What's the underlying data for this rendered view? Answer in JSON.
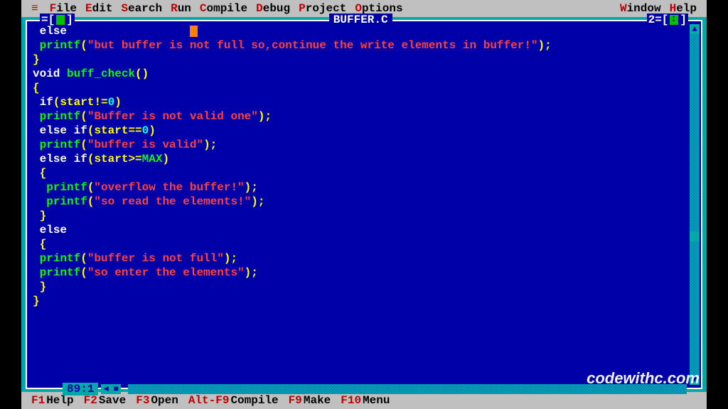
{
  "menu": {
    "items": [
      {
        "hk": "F",
        "rest": "ile"
      },
      {
        "hk": "E",
        "rest": "dit"
      },
      {
        "hk": "S",
        "rest": "earch"
      },
      {
        "hk": "R",
        "rest": "un"
      },
      {
        "hk": "C",
        "rest": "ompile"
      },
      {
        "hk": "D",
        "rest": "ebug"
      },
      {
        "hk": "P",
        "rest": "roject"
      },
      {
        "hk": "O",
        "rest": "ptions"
      }
    ],
    "right": [
      {
        "hk": "W",
        "rest": "indow"
      },
      {
        "hk": "H",
        "rest": "elp"
      }
    ]
  },
  "window": {
    "title": "BUFFER.C",
    "number": "2",
    "position": "89:1"
  },
  "code": [
    {
      "indent": " ",
      "tokens": [
        {
          "t": "else",
          "c": "kw"
        }
      ]
    },
    {
      "indent": " ",
      "tokens": [
        {
          "t": "printf",
          "c": "fn"
        },
        {
          "t": "(",
          "c": "sym"
        },
        {
          "t": "\"but buffer is not full so,continue the write elements in buffer!\"",
          "c": "str"
        },
        {
          "t": ");",
          "c": "sym"
        }
      ]
    },
    {
      "indent": "",
      "tokens": [
        {
          "t": "}",
          "c": "sym"
        }
      ]
    },
    {
      "indent": "",
      "tokens": [
        {
          "t": "void ",
          "c": "typ"
        },
        {
          "t": "buff_check",
          "c": "fn"
        },
        {
          "t": "()",
          "c": "sym"
        }
      ]
    },
    {
      "indent": "",
      "tokens": [
        {
          "t": "{",
          "c": "sym"
        }
      ]
    },
    {
      "indent": " ",
      "tokens": [
        {
          "t": "if",
          "c": "kw"
        },
        {
          "t": "(",
          "c": "sym"
        },
        {
          "t": "start",
          "c": "id"
        },
        {
          "t": "!=",
          "c": "sym"
        },
        {
          "t": "0",
          "c": "num"
        },
        {
          "t": ")",
          "c": "sym"
        }
      ]
    },
    {
      "indent": " ",
      "tokens": [
        {
          "t": "printf",
          "c": "fn"
        },
        {
          "t": "(",
          "c": "sym"
        },
        {
          "t": "\"Buffer is not valid one\"",
          "c": "str"
        },
        {
          "t": ");",
          "c": "sym"
        }
      ]
    },
    {
      "indent": " ",
      "tokens": [
        {
          "t": "else if",
          "c": "kw"
        },
        {
          "t": "(",
          "c": "sym"
        },
        {
          "t": "start",
          "c": "id"
        },
        {
          "t": "==",
          "c": "sym"
        },
        {
          "t": "0",
          "c": "num"
        },
        {
          "t": ")",
          "c": "sym"
        }
      ]
    },
    {
      "indent": " ",
      "tokens": [
        {
          "t": "printf",
          "c": "fn"
        },
        {
          "t": "(",
          "c": "sym"
        },
        {
          "t": "\"buffer is valid\"",
          "c": "str"
        },
        {
          "t": ");",
          "c": "sym"
        }
      ]
    },
    {
      "indent": " ",
      "tokens": [
        {
          "t": "else if",
          "c": "kw"
        },
        {
          "t": "(",
          "c": "sym"
        },
        {
          "t": "start",
          "c": "id"
        },
        {
          "t": ">=",
          "c": "sym"
        },
        {
          "t": "MAX",
          "c": "mac"
        },
        {
          "t": ")",
          "c": "sym"
        }
      ]
    },
    {
      "indent": " ",
      "tokens": [
        {
          "t": "{",
          "c": "sym"
        }
      ]
    },
    {
      "indent": "  ",
      "tokens": [
        {
          "t": "printf",
          "c": "fn"
        },
        {
          "t": "(",
          "c": "sym"
        },
        {
          "t": "\"overflow the buffer!\"",
          "c": "str"
        },
        {
          "t": ");",
          "c": "sym"
        }
      ]
    },
    {
      "indent": "  ",
      "tokens": [
        {
          "t": "printf",
          "c": "fn"
        },
        {
          "t": "(",
          "c": "sym"
        },
        {
          "t": "\"so read the elements!\"",
          "c": "str"
        },
        {
          "t": ");",
          "c": "sym"
        }
      ]
    },
    {
      "indent": " ",
      "tokens": [
        {
          "t": "}",
          "c": "sym"
        }
      ]
    },
    {
      "indent": " ",
      "tokens": [
        {
          "t": "else",
          "c": "kw"
        }
      ]
    },
    {
      "indent": " ",
      "tokens": [
        {
          "t": "{",
          "c": "sym"
        }
      ]
    },
    {
      "indent": " ",
      "tokens": [
        {
          "t": "printf",
          "c": "fn"
        },
        {
          "t": "(",
          "c": "sym"
        },
        {
          "t": "\"buffer is not full\"",
          "c": "str"
        },
        {
          "t": ");",
          "c": "sym"
        }
      ]
    },
    {
      "indent": " ",
      "tokens": [
        {
          "t": "printf",
          "c": "fn"
        },
        {
          "t": "(",
          "c": "sym"
        },
        {
          "t": "\"so enter the elements\"",
          "c": "str"
        },
        {
          "t": ");",
          "c": "sym"
        }
      ]
    },
    {
      "indent": " ",
      "tokens": [
        {
          "t": "}",
          "c": "sym"
        }
      ]
    },
    {
      "indent": "",
      "tokens": [
        {
          "t": "}",
          "c": "sym"
        }
      ]
    }
  ],
  "fkeys": [
    {
      "k": "F1",
      "l": "Help"
    },
    {
      "k": "F2",
      "l": "Save"
    },
    {
      "k": "F3",
      "l": "Open"
    },
    {
      "k": "Alt-F9",
      "l": "Compile"
    },
    {
      "k": "F9",
      "l": "Make"
    },
    {
      "k": "F10",
      "l": "Menu"
    }
  ],
  "watermark": "codewithc.com"
}
